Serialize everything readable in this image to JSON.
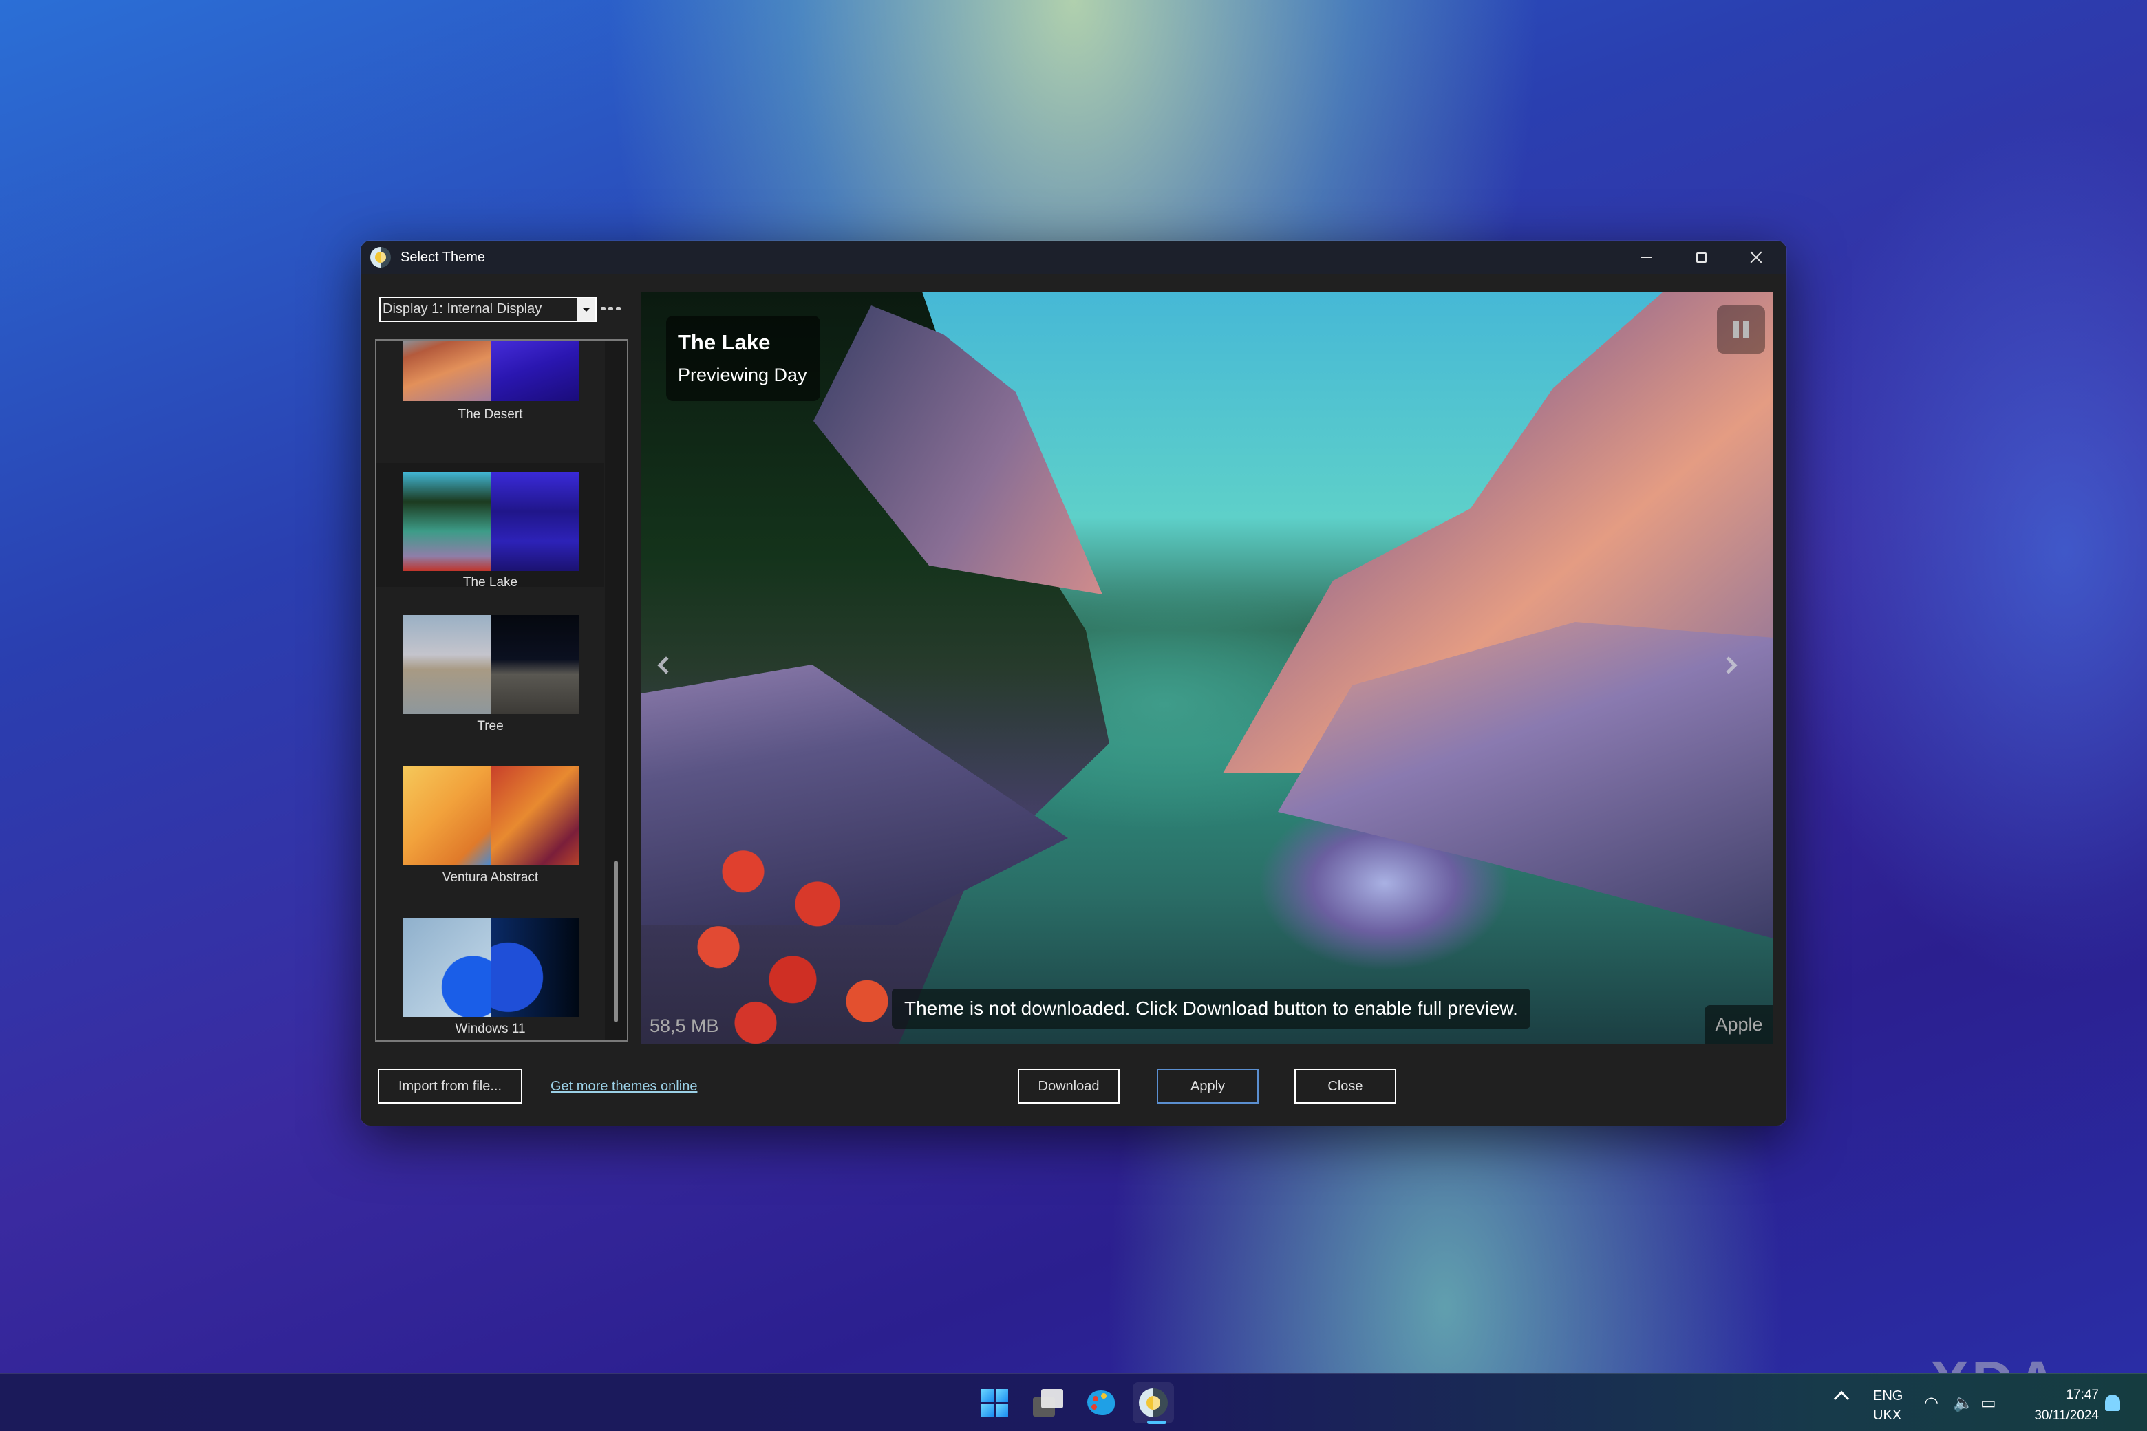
{
  "window": {
    "title": "Select Theme",
    "controls": {
      "minimize": "minimize-icon",
      "maximize": "maximize-icon",
      "close": "close-icon"
    }
  },
  "display_selector": {
    "value": "Display 1: Internal Display",
    "more_icon": "more-horizontal-icon"
  },
  "theme_list": {
    "selected": "The Lake",
    "items": [
      {
        "name": "The Desert",
        "day_color": "#e2905a",
        "night_color": "#3b1fd0"
      },
      {
        "name": "The Lake",
        "day_color": "#3d9c88",
        "night_color": "#2d22b8"
      },
      {
        "name": "Tree",
        "day_color": "#9aa5ad",
        "night_color": "#1c1f26"
      },
      {
        "name": "Ventura Abstract",
        "day_color": "#f2a23c",
        "night_color": "#b7422a"
      },
      {
        "name": "Windows 11",
        "day_color": "#9fc0dc",
        "night_color": "#0a2a66"
      }
    ]
  },
  "preview": {
    "title": "The Lake",
    "subtitle": "Previewing Day",
    "notice": "Theme is not downloaded. Click Download button to enable full preview.",
    "size": "58,5 MB",
    "author": "Apple",
    "pause_icon": "pause-icon",
    "prev_icon": "chevron-left-icon",
    "next_icon": "chevron-right-icon"
  },
  "footer": {
    "import_label": "Import from file...",
    "more_themes_link": "Get more themes online",
    "download_label": "Download",
    "apply_label": "Apply",
    "close_label": "Close"
  },
  "taskbar": {
    "apps": [
      "windows-start-icon",
      "task-view-icon",
      "paint-icon",
      "wintheme-app-icon"
    ],
    "language": "ENG",
    "keyboard": "UKX",
    "time": "17:47",
    "date": "30/11/2024"
  },
  "watermark": "XDA",
  "colors": {
    "dialog_bg": "#202020",
    "titlebar_bg": "#1c202b",
    "link": "#9bd0e6",
    "apply_border": "#5b8fd0",
    "taskbar_active": "#4cc2ff"
  }
}
